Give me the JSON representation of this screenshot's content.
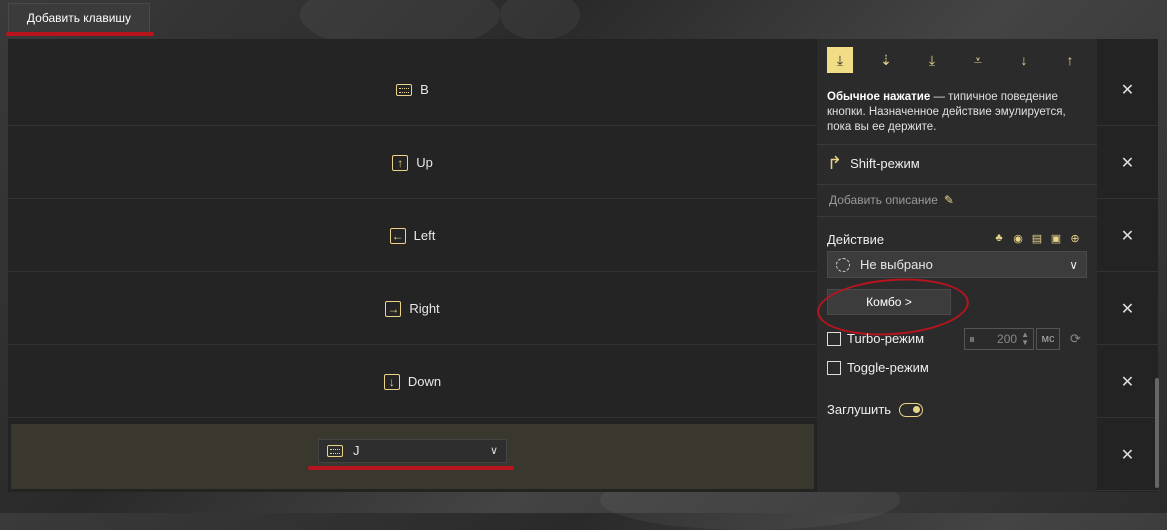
{
  "toolbar": {
    "add_key_label": "Добавить клавишу"
  },
  "rows": [
    {
      "label": "B",
      "icon": "keyboard-icon"
    },
    {
      "label": "Up",
      "icon": "arrow-up-icon"
    },
    {
      "label": "Left",
      "icon": "arrow-left-icon"
    },
    {
      "label": "Right",
      "icon": "arrow-right-icon"
    },
    {
      "label": "Down",
      "icon": "arrow-down-icon"
    }
  ],
  "selected_row": {
    "value": "J",
    "icon": "keyboard-icon"
  },
  "side": {
    "modes": [
      "normal-press-icon",
      "long-press-icon",
      "double-press-icon",
      "triple-press-icon",
      "down-icon",
      "up-icon"
    ],
    "description_bold": "Обычное нажатие",
    "description_rest": " — типичное поведение кнопки. Назначенное действие эмулируется, пока вы ее держите.",
    "shift_mode": "Shift-режим",
    "add_description": "Добавить описание",
    "action_label": "Действие",
    "action_value": "Не выбрано",
    "combo_label": "Комбо >",
    "turbo_label": "Turbo-режим",
    "turbo_value": "200",
    "turbo_unit": "мс",
    "toggle_label": "Toggle-режим",
    "mute_label": "Заглушить",
    "mute_on": true
  },
  "colors": {
    "accent": "#e9d48a",
    "annotation_red": "#b8141e"
  }
}
